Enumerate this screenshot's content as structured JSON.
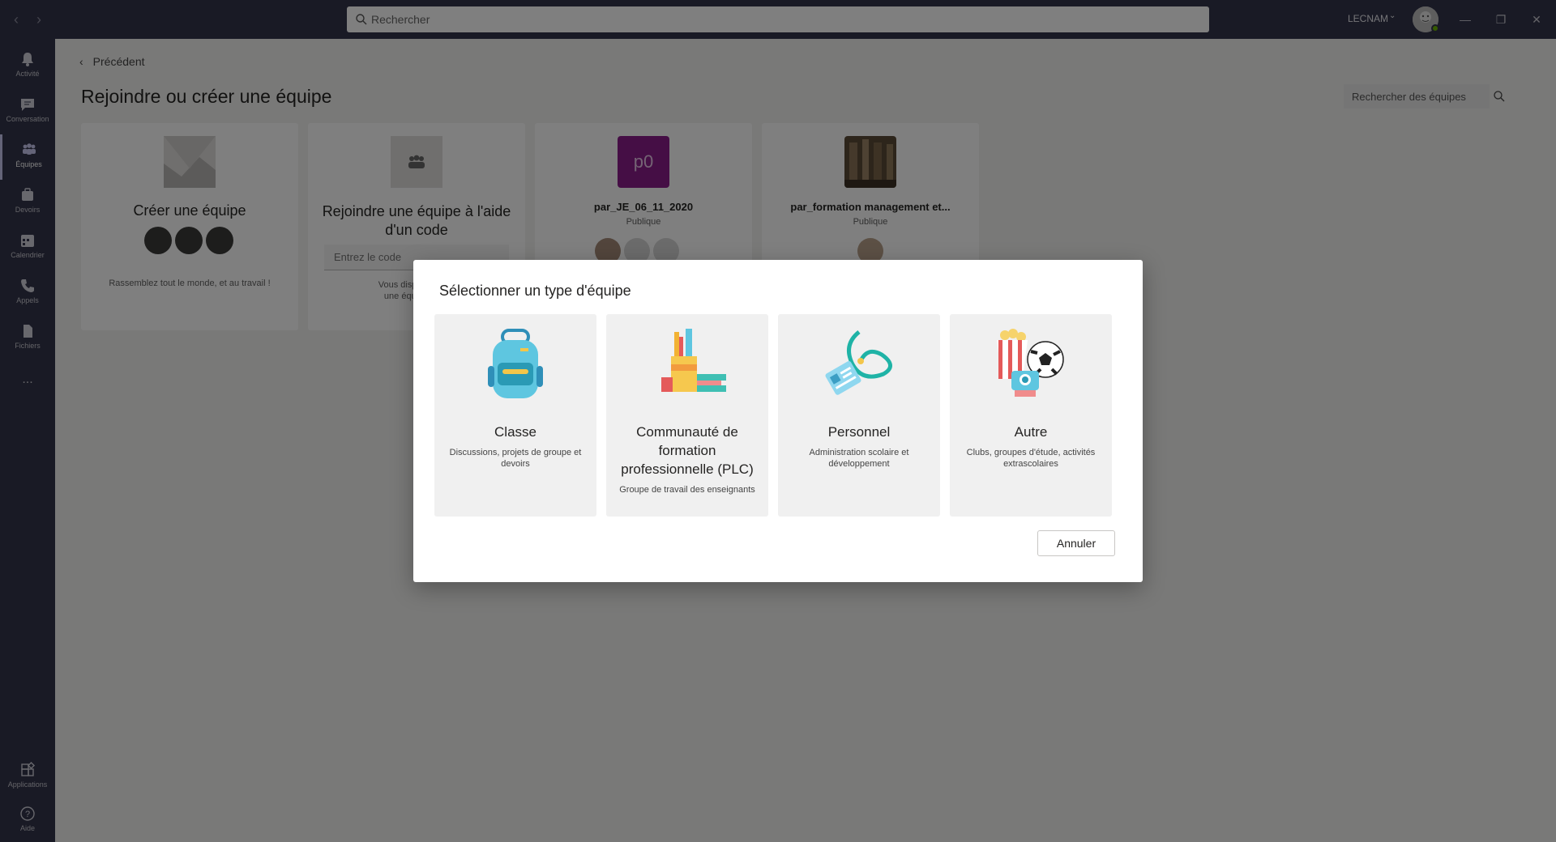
{
  "titlebar": {
    "search_placeholder": "Rechercher",
    "org_name": "LECNAM",
    "back_arrow": "chevron-left-icon",
    "forward_arrow": "chevron-right-icon",
    "window_controls": [
      "minimize-icon",
      "restore-icon",
      "close-icon"
    ],
    "presence_color": "#6bb700"
  },
  "rail": {
    "items": [
      {
        "label": "Activité",
        "icon": "bell-icon"
      },
      {
        "label": "Conversation",
        "icon": "chat-icon"
      },
      {
        "label": "Équipes",
        "icon": "teams-icon"
      },
      {
        "label": "Devoirs",
        "icon": "assignments-icon"
      },
      {
        "label": "Calendrier",
        "icon": "calendar-icon"
      },
      {
        "label": "Appels",
        "icon": "phone-icon"
      },
      {
        "label": "Fichiers",
        "icon": "file-icon"
      },
      {
        "label": "...",
        "icon": "more-icon"
      },
      {
        "label": "Applications",
        "icon": "apps-icon"
      },
      {
        "label": "Aide",
        "icon": "help-icon"
      }
    ],
    "active": "Équipes"
  },
  "page": {
    "back_label": "Précédent",
    "title": "Rejoindre ou créer une équipe",
    "search_placeholder": "Rechercher des équipes"
  },
  "cards": {
    "create": {
      "title": "Créer une équipe",
      "desc": "Rassemblez tout le monde, et au travail !"
    },
    "join": {
      "title": "Rejoindre une équipe à l'aide d'un code",
      "code_placeholder": "Entrez le code",
      "desc_line1": "Vous disposez d'un",
      "desc_line2": "une équipe ? En"
    },
    "team1": {
      "initials": "p0",
      "name": "par_JE_06_11_2020",
      "visibility": "Publique",
      "color": "#8b1c8b"
    },
    "team2": {
      "name": "par_formation management et...",
      "visibility": "Publique"
    }
  },
  "dialog": {
    "title": "Sélectionner un type d'équipe",
    "types": [
      {
        "name": "Classe",
        "desc": "Discussions, projets de groupe et devoirs",
        "icon": "backpack-icon"
      },
      {
        "name": "Communauté de formation professionnelle (PLC)",
        "desc": "Groupe de travail des enseignants",
        "icon": "pencil-cup-books-icon"
      },
      {
        "name": "Personnel",
        "desc": "Administration scolaire et développement",
        "icon": "lanyard-badge-icon"
      },
      {
        "name": "Autre",
        "desc": "Clubs, groupes d'étude, activités extrascolaires",
        "icon": "popcorn-soccer-camera-icon"
      }
    ],
    "cancel_label": "Annuler"
  }
}
